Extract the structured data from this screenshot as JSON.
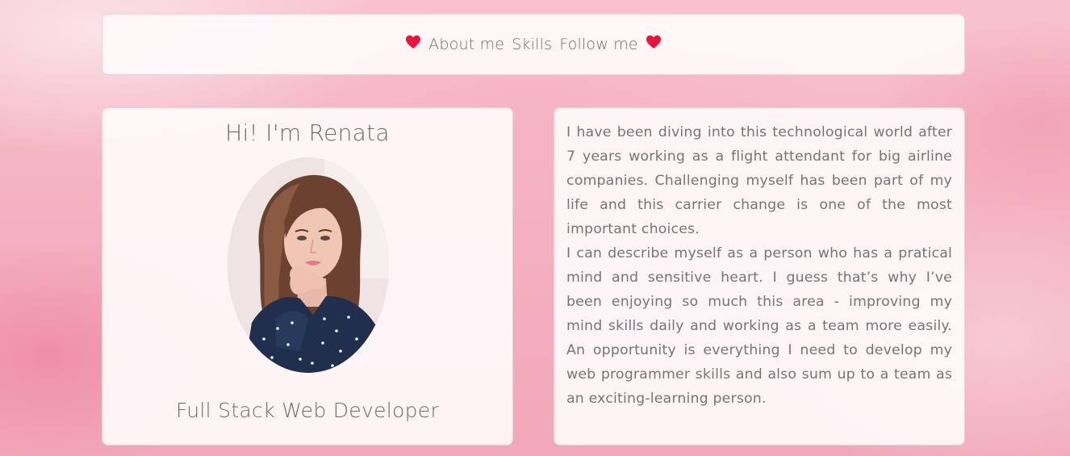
{
  "nav": {
    "links": [
      "About me",
      "Skills",
      "Follow me"
    ],
    "heart_color": "#e8143c"
  },
  "profile": {
    "greeting": "Hi! I'm Renata",
    "title": "Full Stack Web Developer"
  },
  "bio": {
    "paragraph1": "I have been diving into this technological world after 7 years working as a flight attendant for big airline companies. Challenging myself has been part of my life and this carrier change is one of the most important choices.",
    "paragraph2": "I can describe myself as a person who has a pratical mind and sensitive heart. I guess that’s why I’ve been enjoying so much this area - improving my mind skills daily and working as a team more easily. An opportunity is everything I need to develop my web programmer skills and also sum up to a team as an exciting-learning person."
  }
}
